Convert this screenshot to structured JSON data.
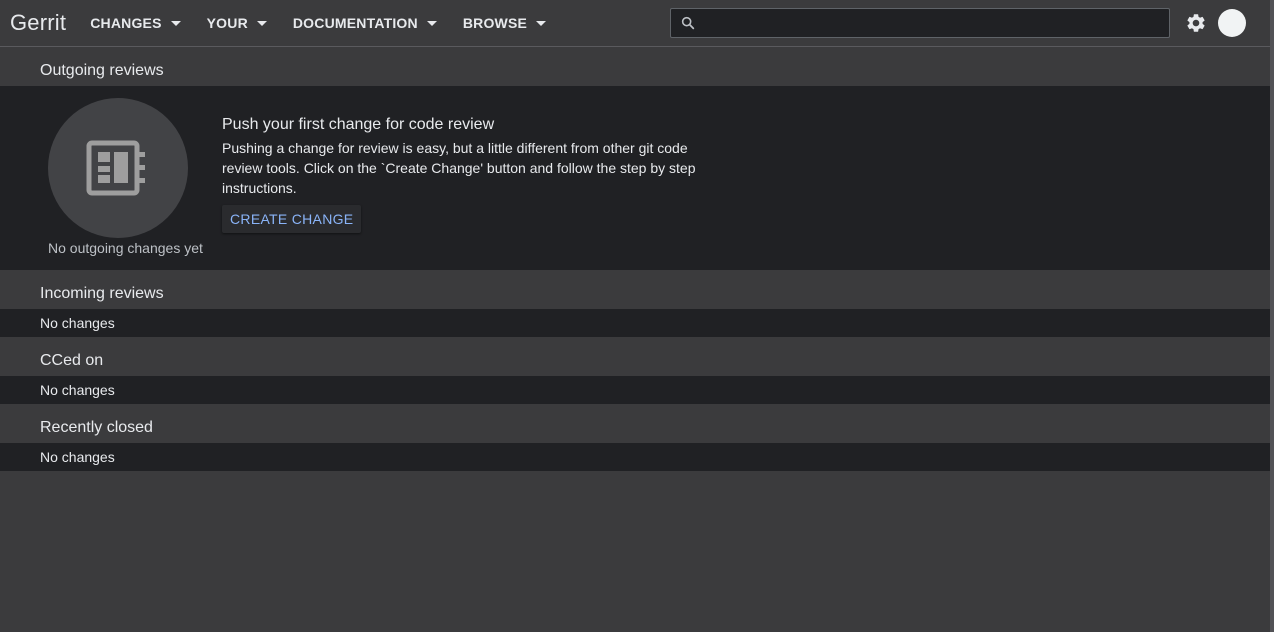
{
  "header": {
    "brand": "Gerrit",
    "menus": [
      {
        "label": "CHANGES"
      },
      {
        "label": "YOUR"
      },
      {
        "label": "DOCUMENTATION"
      },
      {
        "label": "BROWSE"
      }
    ],
    "search": {
      "value": "",
      "placeholder": ""
    }
  },
  "sections": {
    "outgoing": {
      "title": "Outgoing reviews",
      "empty_caption": "No outgoing changes yet",
      "promo_title": "Push your first change for code review",
      "promo_lines": [
        "Pushing a change for review is easy, but a little different from other git code",
        "review tools. Click on the `Create Change' button and follow the step by step",
        "instructions."
      ],
      "create_button": "CREATE CHANGE"
    },
    "incoming": {
      "title": "Incoming reviews",
      "empty": "No changes"
    },
    "cced": {
      "title": "CCed on",
      "empty": "No changes"
    },
    "closed": {
      "title": "Recently closed",
      "empty": "No changes"
    }
  },
  "colors": {
    "background": "#3b3b3d",
    "panel": "#202124",
    "text": "#e8eaed",
    "accent_link": "#8ab4f8"
  },
  "icons": [
    "search-icon",
    "gear-icon",
    "avatar",
    "chevron-down-icon",
    "changes-list-icon"
  ]
}
